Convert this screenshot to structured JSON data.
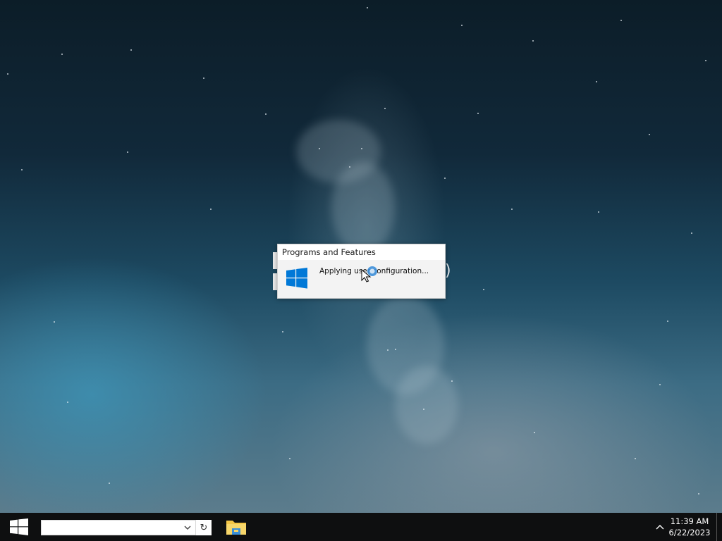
{
  "dialog": {
    "title": "Programs and Features",
    "message": "Applying user configuration..."
  },
  "taskbar": {
    "search": {
      "value": "",
      "placeholder": ""
    },
    "refresh_glyph": "↻",
    "clock": {
      "time": "11:39 AM",
      "date": "6/22/2023"
    },
    "tray_chevron_glyph": "^"
  },
  "icons": {
    "start": "windows-logo-icon",
    "dialog": "windows-logo-icon",
    "explorer": "file-explorer-icon",
    "cursor": "busy-cursor-icon",
    "tray": "chevron-up-icon"
  },
  "colors": {
    "windows_blue": "#0078d7",
    "taskbar_bg": "#0e0f10",
    "folder_yellow": "#f3c545"
  }
}
